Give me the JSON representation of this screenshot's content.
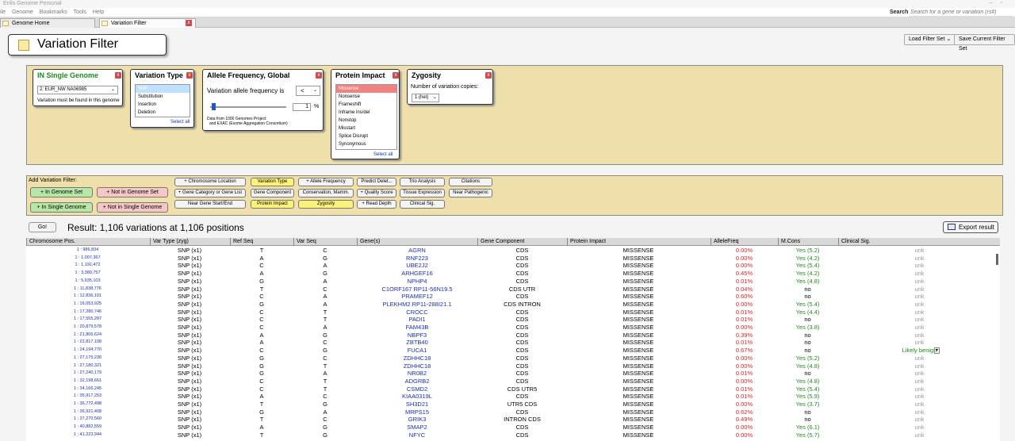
{
  "titlebar": {
    "title": "Enlis Genome Personal"
  },
  "menu": [
    "ile",
    "Genome",
    "Bookmarks",
    "Tools",
    "Help"
  ],
  "search": {
    "label": "Search",
    "placeholder": "Search for a gene or variation (rs#)"
  },
  "tabs": [
    {
      "label": "Genome Home"
    },
    {
      "label": "Variation Filter"
    }
  ],
  "page": {
    "title": "Variation Filter",
    "load_filter_set": "Load Filter Set",
    "save_filter_set": "Save Current Filter Set"
  },
  "filters": {
    "single_genome": {
      "title": "IN Single Genome",
      "selected": "2: EUR_NW NA06985",
      "note": "Variation must be found in this genome"
    },
    "variation_type": {
      "title": "Variation Type",
      "options": [
        "SNP",
        "Substitution",
        "Insertion",
        "Deletion"
      ],
      "select_all": "Select all"
    },
    "allele_freq": {
      "title": "Allele Frequency, Global",
      "label": "Variation allele frequency is",
      "operator": "<",
      "value": "1",
      "unit": "%",
      "note1": "Data from 1000 Genomes Project",
      "note2": "and EXAC (Exome Aggregation Consortium)",
      "slider_level": 0.03
    },
    "protein_impact": {
      "title": "Protein Impact",
      "options": [
        "Missense",
        "Nonsense",
        "Frameshift",
        "Inframe ins/del",
        "Nonstop",
        "Misstart",
        "Splice Disrupt",
        "Synonymous"
      ],
      "select_all": "Select all"
    },
    "zygosity": {
      "title": "Zygosity",
      "label": "Number of variation copies:",
      "selected": "1 (het)"
    }
  },
  "add_filter": {
    "title": "Add Variation Filter:",
    "in_genome_set": "+ In Genome Set",
    "not_in_genome_set": "+ Not in Genome Set",
    "in_single_genome": "+ In Single Genome",
    "not_in_single_genome": "+ Not in Single Genome",
    "buttons": [
      "+ Chromosome Location",
      "Variation Type",
      "+ Allele Frequency",
      "Predict Delet...",
      "Trio Analysis",
      "Citations",
      "+ Gene Category or Gene List",
      "Gene Component",
      "Conservation, Mamm.",
      "+ Quality Score",
      "Tissue Expression",
      "Near Pathogenic",
      "Near Gene Start/End",
      "Protein Impact",
      "Zygosity",
      "+ Read Depth",
      "Clinical Sig."
    ]
  },
  "result": {
    "go": "Go!",
    "text": "Result:  1,106 variations at 1,106 positions",
    "export": "Export result"
  },
  "table": {
    "headers": [
      "Chromosome Pos.",
      "Var Type (zyg)",
      "Ref Seq",
      "Var Seq",
      "Gene(s)",
      "Gene Component",
      "Protein Impact",
      "AlleleFreq",
      "M.Cons",
      "Clinical Sig."
    ],
    "rows": [
      [
        "1 : 986,834",
        "SNP (x1)",
        "T",
        "C",
        "AGRN",
        "CDS",
        "MISSENSE",
        "0.00%",
        "Yes (5.2)",
        "unk"
      ],
      [
        "1 : 1,007,367",
        "SNP (x1)",
        "A",
        "G",
        "RNF223",
        "CDS",
        "MISSENSE",
        "0.00%",
        "Yes (4.2)",
        "unk"
      ],
      [
        "1 : 1,192,472",
        "SNP (x1)",
        "C",
        "A",
        "UBE2J2",
        "CDS",
        "MISSENSE",
        "0.00%",
        "Yes (5.4)",
        "unk"
      ],
      [
        "1 : 3,389,757",
        "SNP (x1)",
        "A",
        "G",
        "ARHGEF16",
        "CDS",
        "MISSENSE",
        "0.45%",
        "Yes (4.2)",
        "unk"
      ],
      [
        "1 : 5,935,103",
        "SNP (x1)",
        "G",
        "A",
        "NPHP4",
        "CDS",
        "MISSENSE",
        "0.01%",
        "Yes (4.8)",
        "unk"
      ],
      [
        "1 : 11,838,776",
        "SNP (x1)",
        "T",
        "C",
        "C1ORF167 RP11-56N19.5",
        "CDS UTR",
        "MISSENSE",
        "0.04%",
        "no",
        "unk"
      ],
      [
        "1 : 12,836,101",
        "SNP (x1)",
        "C",
        "A",
        "PRAMEF12",
        "CDS",
        "MISSENSE",
        "0.60%",
        "no",
        "unk"
      ],
      [
        "1 : 16,053,925",
        "SNP (x1)",
        "G",
        "A",
        "PLEKHM2 RP11-288I21.1",
        "CDS INTRON",
        "MISSENSE",
        "0.00%",
        "Yes (5.4)",
        "unk"
      ],
      [
        "1 : 17,280,746",
        "SNP (x1)",
        "C",
        "T",
        "CROCC",
        "CDS",
        "MISSENSE",
        "0.01%",
        "Yes (4.4)",
        "unk"
      ],
      [
        "1 : 17,555,287",
        "SNP (x1)",
        "C",
        "T",
        "PADI1",
        "CDS",
        "MISSENSE",
        "0.01%",
        "no",
        "unk"
      ],
      [
        "1 : 20,879,578",
        "SNP (x1)",
        "C",
        "A",
        "FAM43B",
        "CDS",
        "MISSENSE",
        "0.00%",
        "Yes (3.8)",
        "unk"
      ],
      [
        "1 : 21,806,624",
        "SNP (x1)",
        "A",
        "G",
        "NBPF3",
        "CDS",
        "MISSENSE",
        "0.39%",
        "no",
        "unk"
      ],
      [
        "1 : 22,817,108",
        "SNP (x1)",
        "A",
        "C",
        "ZBTB40",
        "CDS",
        "MISSENSE",
        "0.01%",
        "no",
        "unk"
      ],
      [
        "1 : 24,194,770",
        "SNP (x1)",
        "C",
        "G",
        "FUCA1",
        "CDS",
        "MISSENSE",
        "0.67%",
        "no",
        "Likely benign"
      ],
      [
        "1 : 27,175,230",
        "SNP (x1)",
        "G",
        "C",
        "ZDHHC18",
        "CDS",
        "MISSENSE",
        "0.00%",
        "Yes (5.2)",
        "unk"
      ],
      [
        "1 : 27,180,321",
        "SNP (x1)",
        "G",
        "T",
        "ZDHHC18",
        "CDS",
        "MISSENSE",
        "0.00%",
        "Yes (4.8)",
        "unk"
      ],
      [
        "1 : 27,240,179",
        "SNP (x1)",
        "G",
        "A",
        "NR0B2",
        "CDS",
        "MISSENSE",
        "0.01%",
        "no",
        "unk"
      ],
      [
        "1 : 32,198,661",
        "SNP (x1)",
        "C",
        "T",
        "ADGRB2",
        "CDS",
        "MISSENSE",
        "0.00%",
        "Yes (4.8)",
        "unk"
      ],
      [
        "1 : 34,166,245",
        "SNP (x1)",
        "C",
        "T",
        "CSMD2",
        "CDS UTR5",
        "MISSENSE",
        "0.01%",
        "Yes (5.4)",
        "unk"
      ],
      [
        "1 : 35,917,253",
        "SNP (x1)",
        "A",
        "C",
        "KIAA0319L",
        "CDS",
        "MISSENSE",
        "0.01%",
        "Yes (5.9)",
        "unk"
      ],
      [
        "1 : 36,772,498",
        "SNP (x1)",
        "T",
        "G",
        "SH3D21",
        "UTR5 CDS",
        "MISSENSE",
        "0.00%",
        "Yes (3.7)",
        "unk"
      ],
      [
        "1 : 36,921,408",
        "SNP (x1)",
        "G",
        "A",
        "MRPS15",
        "CDS",
        "MISSENSE",
        "0.62%",
        "no",
        "unk"
      ],
      [
        "1 : 37,270,560",
        "SNP (x1)",
        "T",
        "C",
        "GRIK3",
        "INTRON CDS",
        "MISSENSE",
        "0.49%",
        "no",
        "unk"
      ],
      [
        "1 : 40,882,559",
        "SNP (x1)",
        "A",
        "G",
        "SMAP2",
        "CDS",
        "MISSENSE",
        "0.00%",
        "Yes (6.1)",
        "unk"
      ],
      [
        "1 : 41,223,944",
        "SNP (x1)",
        "T",
        "G",
        "NFYC",
        "CDS",
        "MISSENSE",
        "0.00%",
        "Yes (5.7)",
        "unk"
      ]
    ]
  }
}
